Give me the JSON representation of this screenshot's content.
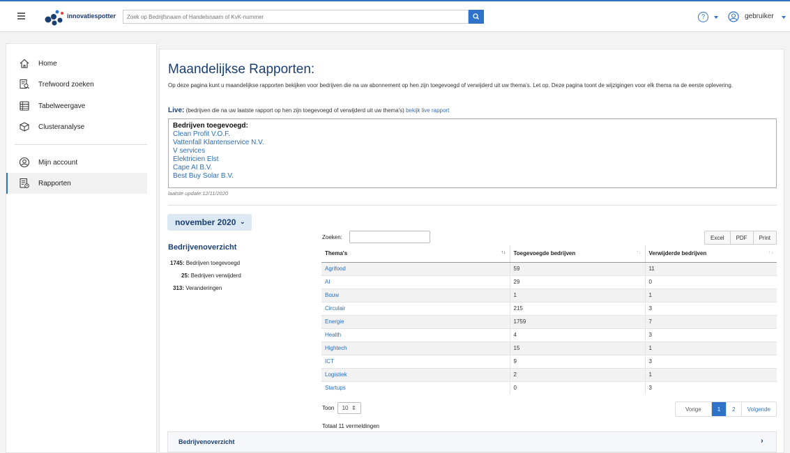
{
  "app": {
    "logo_text": "innovatiespotter",
    "search_placeholder": "Zoek op Bedrijfsnaam of Handelsnaam of KvK-nummer",
    "help_symbol": "?",
    "username": "gebruiker",
    "accent_color": "#2e73c9"
  },
  "sidebar": {
    "items": [
      {
        "label": "Home",
        "icon": "home-icon"
      },
      {
        "label": "Trefwoord zoeken",
        "icon": "keyword-search-icon"
      },
      {
        "label": "Tabelweergave",
        "icon": "table-icon"
      },
      {
        "label": "Clusteranalyse",
        "icon": "cluster-icon"
      },
      {
        "label": "Mijn account",
        "icon": "account-icon"
      },
      {
        "label": "Rapporten",
        "icon": "report-icon",
        "active": true
      }
    ]
  },
  "page": {
    "title": "Maandelijkse Rapporten:",
    "intro": "Op deze pagina kunt u maandelijkse rapporten bekijken voor bedrijven die na uw abonnement op hen zijn toegevoegd of verwijderd uit uw thema's. Let op. Deze pagina toont de wijzigingen voor elk thema na de eerste oplevering.",
    "live_label": "Live:",
    "live_desc": " (bedrijven die na uw laatste rapport op hen zijn toegevoegd of verwijderd uit uw thema's) ",
    "live_link": "bekijk live rapport",
    "live_box_header": "Bedrijven toegevoegd:",
    "live_companies": [
      "Clean Profit V.O.F.",
      "Vattenfall Klantenservice N.V.",
      "V services",
      "Elektricien Elst",
      "Cape AI B.V.",
      "Best Buy Solar B.V."
    ],
    "last_update": "laatste update:12/11/2020"
  },
  "report": {
    "month": "november 2020",
    "overview_title": "Bedrijvenoverzicht",
    "stats": [
      {
        "value": "1745:",
        "label": "Bedrijven toegevoegd"
      },
      {
        "value": "25:",
        "label": "Bedrijven verwijderd"
      },
      {
        "value": "313:",
        "label": "Veranderingen"
      }
    ],
    "search_label": "Zoeken:",
    "buttons": [
      "Excel",
      "PDF",
      "Print"
    ],
    "columns": [
      "Thema's",
      "Toegevoegde bedrijven",
      "Verwijderde bedrijven"
    ],
    "rows": [
      [
        "Agrifood",
        "59",
        "11"
      ],
      [
        "AI",
        "29",
        "0"
      ],
      [
        "Bouw",
        "1",
        "1"
      ],
      [
        "Circulair",
        "215",
        "3"
      ],
      [
        "Energie",
        "1759",
        "7"
      ],
      [
        "Health",
        "4",
        "3"
      ],
      [
        "Hightech",
        "15",
        "1"
      ],
      [
        "ICT",
        "9",
        "3"
      ],
      [
        "Logistiek",
        "2",
        "1"
      ],
      [
        "Startups",
        "0",
        "3"
      ]
    ],
    "toon_label": "Toon",
    "page_size": "10",
    "total": "Totaal 11 vermeldingen",
    "pager": {
      "prev": "Vorige",
      "pages": [
        "1",
        "2"
      ],
      "next": "Volgende"
    },
    "collapse_title": "Bedrijvenoverzicht"
  }
}
